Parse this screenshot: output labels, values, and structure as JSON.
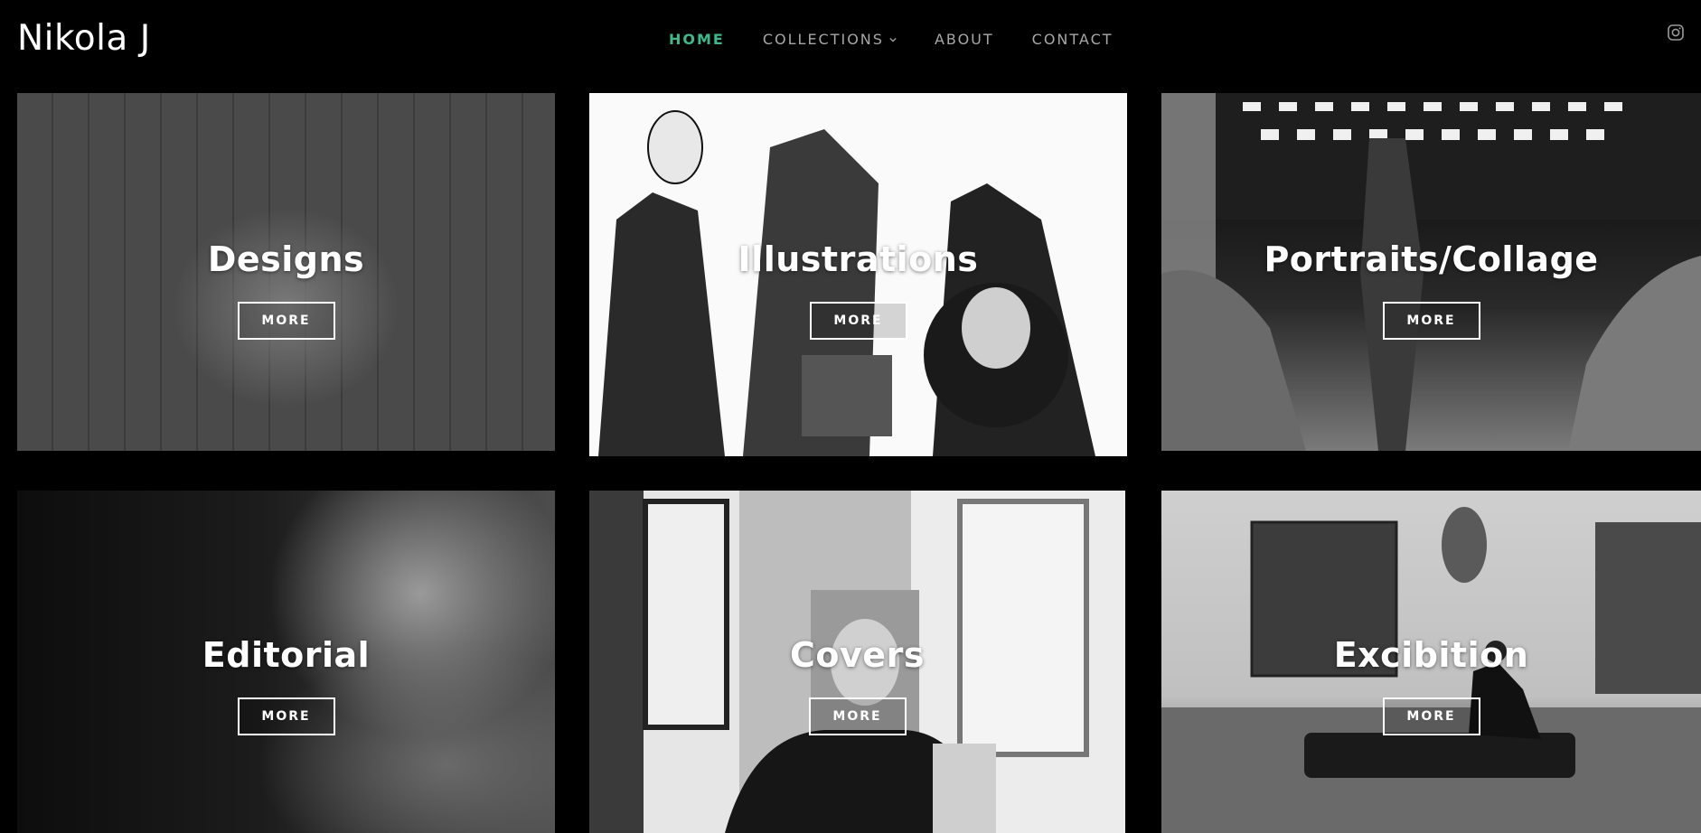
{
  "header": {
    "logo": "Nikola J",
    "nav": [
      {
        "label": "HOME",
        "active": true
      },
      {
        "label": "COLLECTIONS",
        "has_dropdown": true
      },
      {
        "label": "ABOUT"
      },
      {
        "label": "CONTACT"
      }
    ],
    "social_icon": "instagram-icon"
  },
  "colors": {
    "background": "#000000",
    "active_nav": "#3fb98b",
    "nav_text": "#a7a7a7",
    "text": "#ffffff"
  },
  "tiles": [
    {
      "title": "Designs",
      "button": "MORE"
    },
    {
      "title": "Illustrations",
      "button": "MORE"
    },
    {
      "title": "Portraits/Collage",
      "button": "MORE"
    },
    {
      "title": "Editorial",
      "button": "MORE"
    },
    {
      "title": "Covers",
      "button": "MORE"
    },
    {
      "title": "Excibition",
      "button": "MORE"
    }
  ]
}
